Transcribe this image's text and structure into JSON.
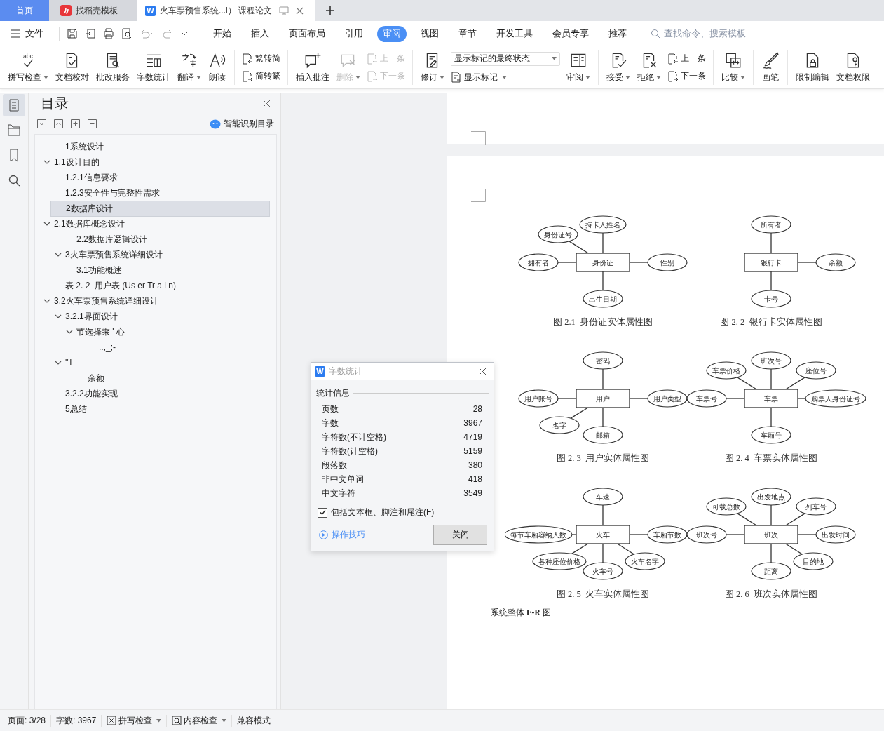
{
  "tabs": [
    {
      "kind": "home",
      "label": "首页",
      "selected": false
    },
    {
      "kind": "template",
      "label": "找稻壳模板",
      "selected": false
    },
    {
      "kind": "document",
      "badge": "W",
      "label": "火车票预售系统...l）  课程论文",
      "selected": true
    }
  ],
  "menu": {
    "file": "文件",
    "tabs": [
      {
        "label": "开始",
        "selected": false
      },
      {
        "label": "插入",
        "selected": false
      },
      {
        "label": "页面布局",
        "selected": false
      },
      {
        "label": "引用",
        "selected": false
      },
      {
        "label": "审阅",
        "selected": true
      },
      {
        "label": "视图",
        "selected": false
      },
      {
        "label": "章节",
        "selected": false
      },
      {
        "label": "开发工具",
        "selected": false
      },
      {
        "label": "会员专享",
        "selected": false
      },
      {
        "label": "推荐",
        "selected": false
      }
    ],
    "search": {
      "placeholder": "查找命令、搜索模板"
    }
  },
  "ribbon": [
    {
      "items": [
        {
          "kind": "large",
          "label": "拼写检查",
          "icon_text": "abc",
          "dropdown": true,
          "disabled": false
        },
        {
          "kind": "large",
          "label": "文档校对",
          "dropdown": false,
          "disabled": false
        },
        {
          "kind": "large",
          "label": "批改服务",
          "dropdown": false,
          "disabled": false
        },
        {
          "kind": "large",
          "label": "字数统计",
          "dropdown": false,
          "disabled": false
        },
        {
          "kind": "large",
          "label": "翻译",
          "dropdown": true,
          "disabled": false
        },
        {
          "kind": "large",
          "label": "朗读",
          "dropdown": false,
          "disabled": false
        }
      ]
    },
    {
      "items": [
        {
          "kind": "stack",
          "items": [
            {
              "label": "繁转简",
              "disabled": false
            },
            {
              "label": "简转繁",
              "disabled": false
            }
          ]
        }
      ]
    },
    {
      "items": [
        {
          "kind": "large",
          "label": "插入批注",
          "dropdown": false,
          "disabled": false
        },
        {
          "kind": "large",
          "label": "删除",
          "dropdown": true,
          "disabled": true
        },
        {
          "kind": "stack",
          "items": [
            {
              "label": "上一条",
              "disabled": true
            },
            {
              "label": "下一条",
              "disabled": true
            }
          ]
        }
      ]
    },
    {
      "items": [
        {
          "kind": "large",
          "label": "修订",
          "dropdown": true,
          "disabled": false
        },
        {
          "kind": "select",
          "value": "显示标记的最终状态",
          "below": {
            "label": "显示标记",
            "dropdown": true
          }
        },
        {
          "kind": "large",
          "label": "审阅",
          "dropdown": true,
          "disabled": false
        }
      ]
    },
    {
      "items": [
        {
          "kind": "large",
          "label": "接受",
          "dropdown": true,
          "disabled": false
        },
        {
          "kind": "large",
          "label": "拒绝",
          "dropdown": true,
          "disabled": false
        },
        {
          "kind": "stack",
          "items": [
            {
              "label": "上一条",
              "disabled": false
            },
            {
              "label": "下一条",
              "disabled": false
            }
          ]
        }
      ]
    },
    {
      "items": [
        {
          "kind": "large",
          "label": "比较",
          "dropdown": true,
          "disabled": false
        }
      ]
    },
    {
      "items": [
        {
          "kind": "large",
          "label": "画笔",
          "dropdown": false,
          "disabled": false
        }
      ]
    },
    {
      "items": [
        {
          "kind": "large",
          "label": "限制编辑",
          "dropdown": false,
          "disabled": false
        },
        {
          "kind": "large",
          "label": "文档权限",
          "dropdown": false,
          "disabled": false
        }
      ]
    }
  ],
  "toc": {
    "title": "目录",
    "smart_button": "智能识别目录",
    "items": [
      {
        "label": "1系统设计",
        "selected": false
      },
      {
        "label": "1.1设计目的",
        "selected": false,
        "expanded": true
      },
      {
        "label": "1.2.1信息要求",
        "selected": false
      },
      {
        "label": "1.2.3安全性与完整性需求",
        "selected": false
      },
      {
        "label": "2数据库设计",
        "selected": true
      },
      {
        "label": "2.1数据库概念设计",
        "selected": false,
        "expanded": true,
        "children": [
          {
            "label": "2.2数据库逻辑设计",
            "selected": false
          },
          {
            "label": "3火车票预售系统详细设计",
            "selected": false,
            "expanded": true
          },
          {
            "label": "3.1功能概述",
            "selected": false
          }
        ]
      },
      {
        "label": "表 2. 2  用户表 (Us er Tr a i n)",
        "selected": false
      },
      {
        "label": "3.2火车票预售系统详细设计",
        "selected": false,
        "expanded": true,
        "children": [
          {
            "label": "3.2.1界面设计",
            "selected": false,
            "expanded": true,
            "children": [
              {
                "label": "节选择乘 ' 心",
                "selected": false,
                "expanded": true,
                "children": [
                  {
                    "label": "..,_;-",
                    "selected": false
                  }
                ]
              }
            ]
          },
          {
            "label": "'\"l",
            "selected": false,
            "expanded": true,
            "children": [
              {
                "label": "余额",
                "selected": false
              }
            ]
          }
        ]
      },
      {
        "label": "3.2.2功能实现",
        "selected": false
      },
      {
        "label": "5总结",
        "selected": false
      }
    ]
  },
  "figures": [
    {
      "entity": "身份证",
      "caption": "图 2.1  身份证实体属性图",
      "attributes": [
        {
          "label": "身份证号",
          "kind": "top-left"
        },
        {
          "label": "持卡人姓名",
          "kind": "top"
        },
        {
          "label": "拥有者",
          "kind": "left"
        },
        {
          "label": "性别",
          "kind": "right"
        },
        {
          "label": "出生日期",
          "kind": "bottom"
        }
      ]
    },
    {
      "entity": "银行卡",
      "caption": "图 2. 2  银行卡实体属性图",
      "attributes": [
        {
          "label": "所有者",
          "kind": "top"
        },
        {
          "label": "余额",
          "kind": "right"
        },
        {
          "label": "卡号",
          "kind": "bottom"
        }
      ]
    },
    {
      "entity": "用户",
      "caption": "图 2. 3  用户实体属性图",
      "attributes": [
        {
          "label": "密码",
          "kind": "top"
        },
        {
          "label": "用户账号",
          "kind": "left"
        },
        {
          "label": "用户类型",
          "kind": "right"
        },
        {
          "label": "名字",
          "kind": "bottom-left"
        },
        {
          "label": "邮箱",
          "kind": "bottom"
        }
      ]
    },
    {
      "entity": "车票",
      "caption": "图 2. 4  车票实体属性图",
      "attributes": [
        {
          "label": "车票价格",
          "kind": "top-left"
        },
        {
          "label": "班次号",
          "kind": "top"
        },
        {
          "label": "座位号",
          "kind": "top-right"
        },
        {
          "label": "车票号",
          "kind": "left"
        },
        {
          "label": "购票人身份证号",
          "kind": "right"
        },
        {
          "label": "车厢号",
          "kind": "bottom"
        }
      ]
    },
    {
      "entity": "火车",
      "caption": "图 2. 5  火车实体属性图",
      "attributes": [
        {
          "label": "车速",
          "kind": "top"
        },
        {
          "label": "每节车厢容纳人数",
          "kind": "left"
        },
        {
          "label": "车厢节数",
          "kind": "right"
        },
        {
          "label": "各种座位价格",
          "kind": "bottom-left"
        },
        {
          "label": "火车号",
          "kind": "bottom"
        },
        {
          "label": "火车名字",
          "kind": "bottom-right"
        }
      ]
    },
    {
      "entity": "班次",
      "caption": "图 2. 6  班次实体属性图",
      "attributes": [
        {
          "label": "可载总数",
          "kind": "top-left"
        },
        {
          "label": "出发地点",
          "kind": "top"
        },
        {
          "label": "列车号",
          "kind": "top-right"
        },
        {
          "label": "班次号",
          "kind": "left"
        },
        {
          "label": "出发时间",
          "kind": "right"
        },
        {
          "label": "目的地",
          "kind": "bottom-right"
        },
        {
          "label": "距离",
          "kind": "bottom"
        }
      ]
    }
  ],
  "doc_text": "系统整体 **E-R** 图",
  "dialog": {
    "badge": "W",
    "title": "字数统计",
    "section": "统计信息",
    "rows": [
      {
        "label": "页数",
        "value": "28"
      },
      {
        "label": "字数",
        "value": "3967"
      },
      {
        "label": "字符数(不计空格)",
        "value": "4719"
      },
      {
        "label": "字符数(计空格)",
        "value": "5159"
      },
      {
        "label": "段落数",
        "value": "380"
      },
      {
        "label": "非中文单词",
        "value": "418"
      },
      {
        "label": "中文字符",
        "value": "3549"
      }
    ],
    "checkbox": {
      "label": "包括文本框、脚注和尾注(F)",
      "checked": true
    },
    "link": "操作技巧",
    "button": "关闭"
  },
  "status_bar": {
    "page": "页面: 3/28",
    "words": "字数: 3967",
    "spell": "拼写检查",
    "content": "内容检查",
    "mode": "兼容模式"
  }
}
